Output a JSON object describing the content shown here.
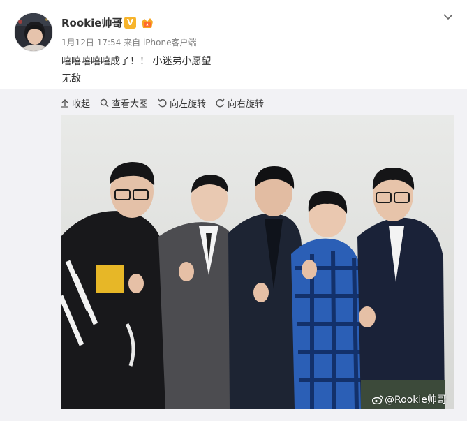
{
  "post": {
    "author": "Rookie帅哥",
    "timestamp": "1月12日 17:54",
    "source": "来自 iPhone客户端",
    "verified_badge": "V",
    "text_line1": "嘻嘻嘻嘻嘻成了！！ 小迷弟小愿望",
    "text_line2": "无敌"
  },
  "toolbar": {
    "items": [
      {
        "label": "收起",
        "icon": "collapse-up-icon"
      },
      {
        "label": "查看大图",
        "icon": "search-icon"
      },
      {
        "label": "向左旋转",
        "icon": "rotate-left-icon"
      },
      {
        "label": "向右旋转",
        "icon": "rotate-right-icon"
      }
    ]
  },
  "image": {
    "watermark": "@Rookie帅哥"
  },
  "colors": {
    "accent_badge": "#f7b42c",
    "toolbar_bg": "#f2f2f5",
    "meta_text": "#808080"
  }
}
